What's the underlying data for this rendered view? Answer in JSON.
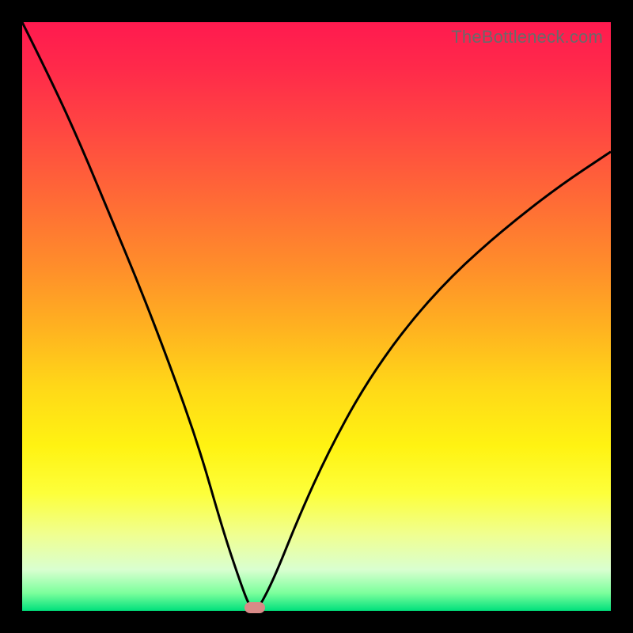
{
  "watermark": "TheBottleneck.com",
  "chart_data": {
    "type": "line",
    "title": "",
    "xlabel": "",
    "ylabel": "",
    "xlim": [
      0,
      1
    ],
    "ylim": [
      0,
      1
    ],
    "grid": false,
    "legend": false,
    "series": [
      {
        "name": "bottleneck-curve",
        "x": [
          0.0,
          0.05,
          0.1,
          0.15,
          0.2,
          0.25,
          0.3,
          0.34,
          0.37,
          0.385,
          0.395,
          0.405,
          0.43,
          0.47,
          0.52,
          0.58,
          0.65,
          0.73,
          0.82,
          0.91,
          1.0
        ],
        "y": [
          1.0,
          0.9,
          0.79,
          0.67,
          0.55,
          0.42,
          0.28,
          0.14,
          0.05,
          0.01,
          0.0,
          0.01,
          0.06,
          0.16,
          0.27,
          0.38,
          0.48,
          0.57,
          0.65,
          0.72,
          0.78
        ]
      }
    ],
    "marker": {
      "x": 0.395,
      "y": 0.005
    },
    "colors": {
      "curve": "#000000",
      "marker": "#d98a87",
      "gradient_top": "#ff1a4f",
      "gradient_bottom": "#00e07c"
    }
  }
}
